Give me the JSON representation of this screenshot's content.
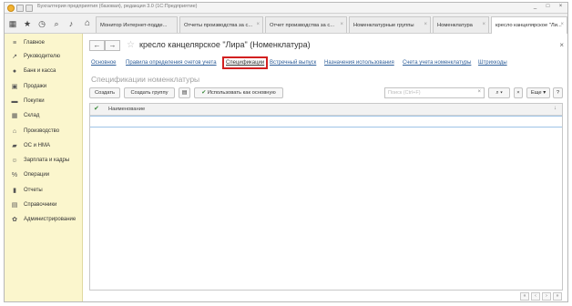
{
  "window": {
    "title": "Бухгалтерия предприятия (базовая), редакция 3.0 (1С:Предприятие)",
    "buttons": [
      "_",
      "□",
      "×"
    ]
  },
  "toolbar_icons": [
    "grid-icon",
    "star-icon",
    "history-icon",
    "search-icon",
    "bell-icon"
  ],
  "tabs": [
    {
      "label": "Монитор Интернет-подде..."
    },
    {
      "label": "Отчеты производства за с..."
    },
    {
      "label": "Отчет производства за с..."
    },
    {
      "label": "Номенклатурные группы"
    },
    {
      "label": "Номенклатура"
    },
    {
      "label": "кресло канцелярское \"Ли..."
    }
  ],
  "sidebar": {
    "items": [
      {
        "label": "Главное",
        "icon": "≡"
      },
      {
        "label": "Руководителю",
        "icon": "↗"
      },
      {
        "label": "Банк и касса",
        "icon": "●"
      },
      {
        "label": "Продажи",
        "icon": "▣"
      },
      {
        "label": "Покупки",
        "icon": "▬"
      },
      {
        "label": "Склад",
        "icon": "▦"
      },
      {
        "label": "Производство",
        "icon": "⌂"
      },
      {
        "label": "ОС и НМА",
        "icon": "▰"
      },
      {
        "label": "Зарплата и кадры",
        "icon": "☺"
      },
      {
        "label": "Операции",
        "icon": "%"
      },
      {
        "label": "Отчеты",
        "icon": "▮"
      },
      {
        "label": "Справочники",
        "icon": "▤"
      },
      {
        "label": "Администрирование",
        "icon": "✿"
      }
    ]
  },
  "form": {
    "back": "←",
    "forward": "→",
    "star": "☆",
    "title": "кресло канцелярское \"Лира\" (Номенклатура)",
    "close": "×",
    "links": [
      "Основное",
      "Правила определения счетов учета",
      "Спецификации",
      "Встречный выпуск",
      "Назначения использования",
      "Счета учета номенклатуры",
      "Штрихкоды"
    ],
    "subtitle": "Спецификации номенклатуры",
    "buttons": {
      "create": "Создать",
      "create_group": "Создать группу",
      "use_default": "Использовать как основную",
      "more": "Еще",
      "help": "?"
    },
    "search_placeholder": "Поиск (Ctrl+F)",
    "table": {
      "columns": [
        "Наименование"
      ]
    },
    "pager": [
      "«",
      "‹",
      "›",
      "»"
    ]
  }
}
